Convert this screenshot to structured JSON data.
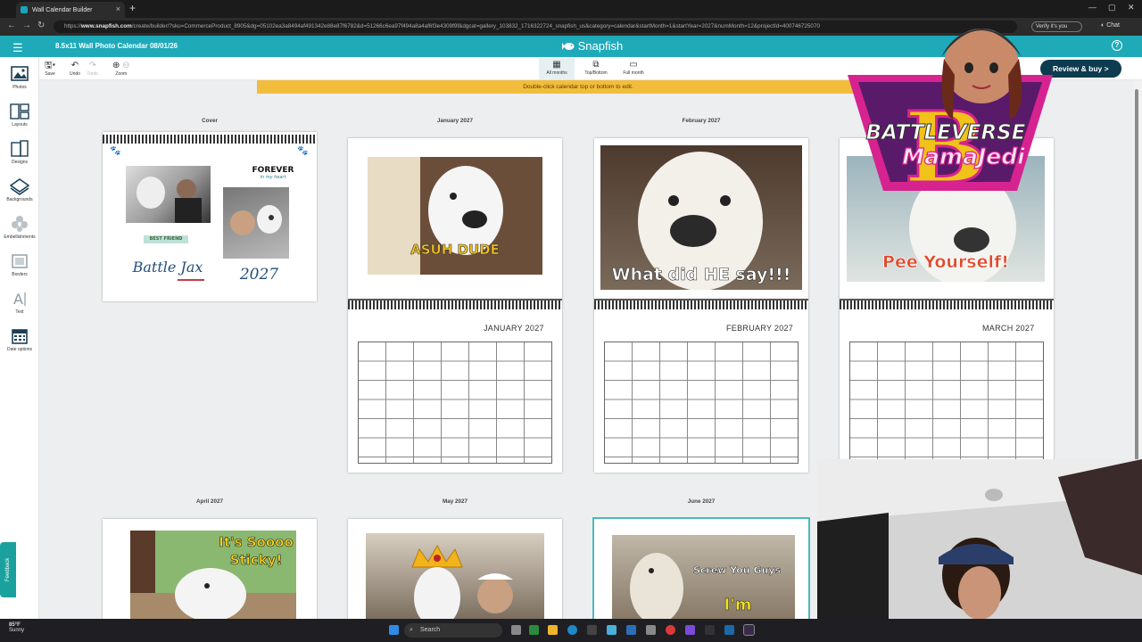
{
  "browser": {
    "tab_title": "Wall Calendar Builder",
    "url_prefix": "https://",
    "url_host": "www.snapfish.com",
    "url_path": "/create/builder/?sku=CommerceProduct_8905&dg=05102ea3a8494af491342e88e87f6782&d=51266c6ea97f494a8a4af6f3e4309f9f&dgcat=gallery_103832_1716322724_snapfish_us&category=calendar&startMonth=1&startYear=2027&numMonth=12&projectId=400746725070",
    "verify_label": "Verify it's you",
    "chat_label": "Chat"
  },
  "app": {
    "project_title": "8.5x11 Wall Photo Calendar  08/01/26",
    "brand": "Snapfish",
    "review_button": "Review & buy >",
    "hint": "Double-click calendar top or bottom to edit."
  },
  "sidebar": {
    "items": [
      {
        "label": "Photos",
        "icon": "photos-icon"
      },
      {
        "label": "Layouts",
        "icon": "layouts-icon"
      },
      {
        "label": "Designs",
        "icon": "designs-icon"
      },
      {
        "label": "Backgrounds",
        "icon": "backgrounds-icon"
      },
      {
        "label": "Embellishments",
        "icon": "embellishments-icon"
      },
      {
        "label": "Borders",
        "icon": "borders-icon"
      },
      {
        "label": "Text",
        "icon": "text-icon"
      },
      {
        "label": "Date options",
        "icon": "calendar-icon"
      }
    ],
    "feedback": "Feedback"
  },
  "toolbar": {
    "save": "Save",
    "undo": "Undo",
    "redo": "Redo",
    "zoom": "Zoom",
    "views": [
      "All months",
      "Top/Bottom",
      "Full month"
    ]
  },
  "pages": {
    "cover": {
      "label": "Cover",
      "forever": "FOREVER",
      "heart": "in my heart",
      "best_friend": "BEST FRIEND",
      "name": "Battle Jax",
      "year": "2027"
    },
    "jan": {
      "label": "January 2027",
      "caption": "ASUH DUDE",
      "month": "JANUARY 2027"
    },
    "feb": {
      "label": "February 2027",
      "caption": "What did HE say!!!",
      "month": "FEBRUARY 2027"
    },
    "mar": {
      "caption": "Pee Yourself!",
      "month": "MARCH 2027"
    },
    "apr": {
      "label": "April 2027",
      "caption": "It's Soooo Sticky!"
    },
    "may": {
      "label": "May 2027"
    },
    "jun": {
      "label": "June 2027",
      "caption": "Screw You Guys",
      "caption2": "I'm"
    }
  },
  "overlay": {
    "logo_line1": "BATTLEVERSE",
    "logo_line2": "MamaJedi",
    "logo_letter": "B"
  },
  "taskbar": {
    "temp": "85°F",
    "weather": "Sunny",
    "search": "Search"
  },
  "colors": {
    "teal": "#1eaab9",
    "navy_button": "#0d3b4f",
    "hint_yellow": "#f2bd3c",
    "selected_outline": "#4fb8be"
  }
}
